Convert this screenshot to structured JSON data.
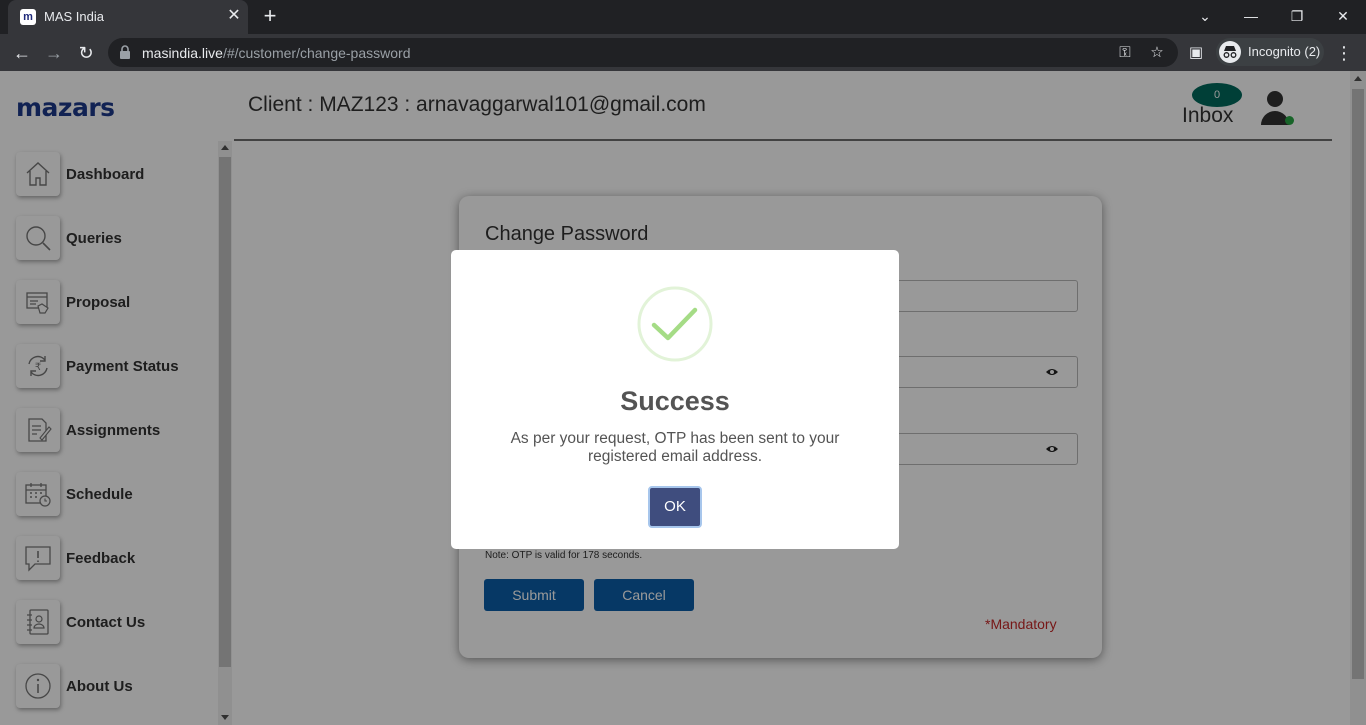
{
  "browser": {
    "tab_title": "MAS India",
    "tab_favicon_letter": "m",
    "url_host": "masindia.live",
    "url_path": "/#/customer/change-password",
    "incognito_label": "Incognito (2)"
  },
  "app": {
    "logo_text": "mazars",
    "header": {
      "client_title": "Client : MAZ123 : arnavaggarwal101@gmail.com",
      "inbox_count": "0",
      "inbox_label": "Inbox"
    },
    "sidebar": {
      "items": [
        {
          "label": "Dashboard",
          "icon": "home-icon"
        },
        {
          "label": "Queries",
          "icon": "search-icon"
        },
        {
          "label": "Proposal",
          "icon": "proposal-icon"
        },
        {
          "label": "Payment Status",
          "icon": "rupee-refresh-icon"
        },
        {
          "label": "Assignments",
          "icon": "assignment-icon"
        },
        {
          "label": "Schedule",
          "icon": "calendar-icon"
        },
        {
          "label": "Feedback",
          "icon": "feedback-icon"
        },
        {
          "label": "Contact Us",
          "icon": "contact-book-icon"
        },
        {
          "label": "About Us",
          "icon": "info-icon"
        }
      ]
    },
    "change_password": {
      "title": "Change Password",
      "note": "Note: OTP is valid for 178 seconds.",
      "submit_label": "Submit",
      "cancel_label": "Cancel",
      "mandatory_label": "*Mandatory"
    },
    "modal": {
      "title": "Success",
      "message": "As per your request, OTP has been sent to your registered email address.",
      "ok_label": "OK"
    }
  },
  "colors": {
    "primary_button": "#0a5ea8",
    "inbox_badge": "#00695c",
    "ok_button": "#3f4d7e",
    "success_green": "#a5dc86",
    "mandatory_red": "#c62828",
    "logo_blue": "#1d3a8a"
  }
}
